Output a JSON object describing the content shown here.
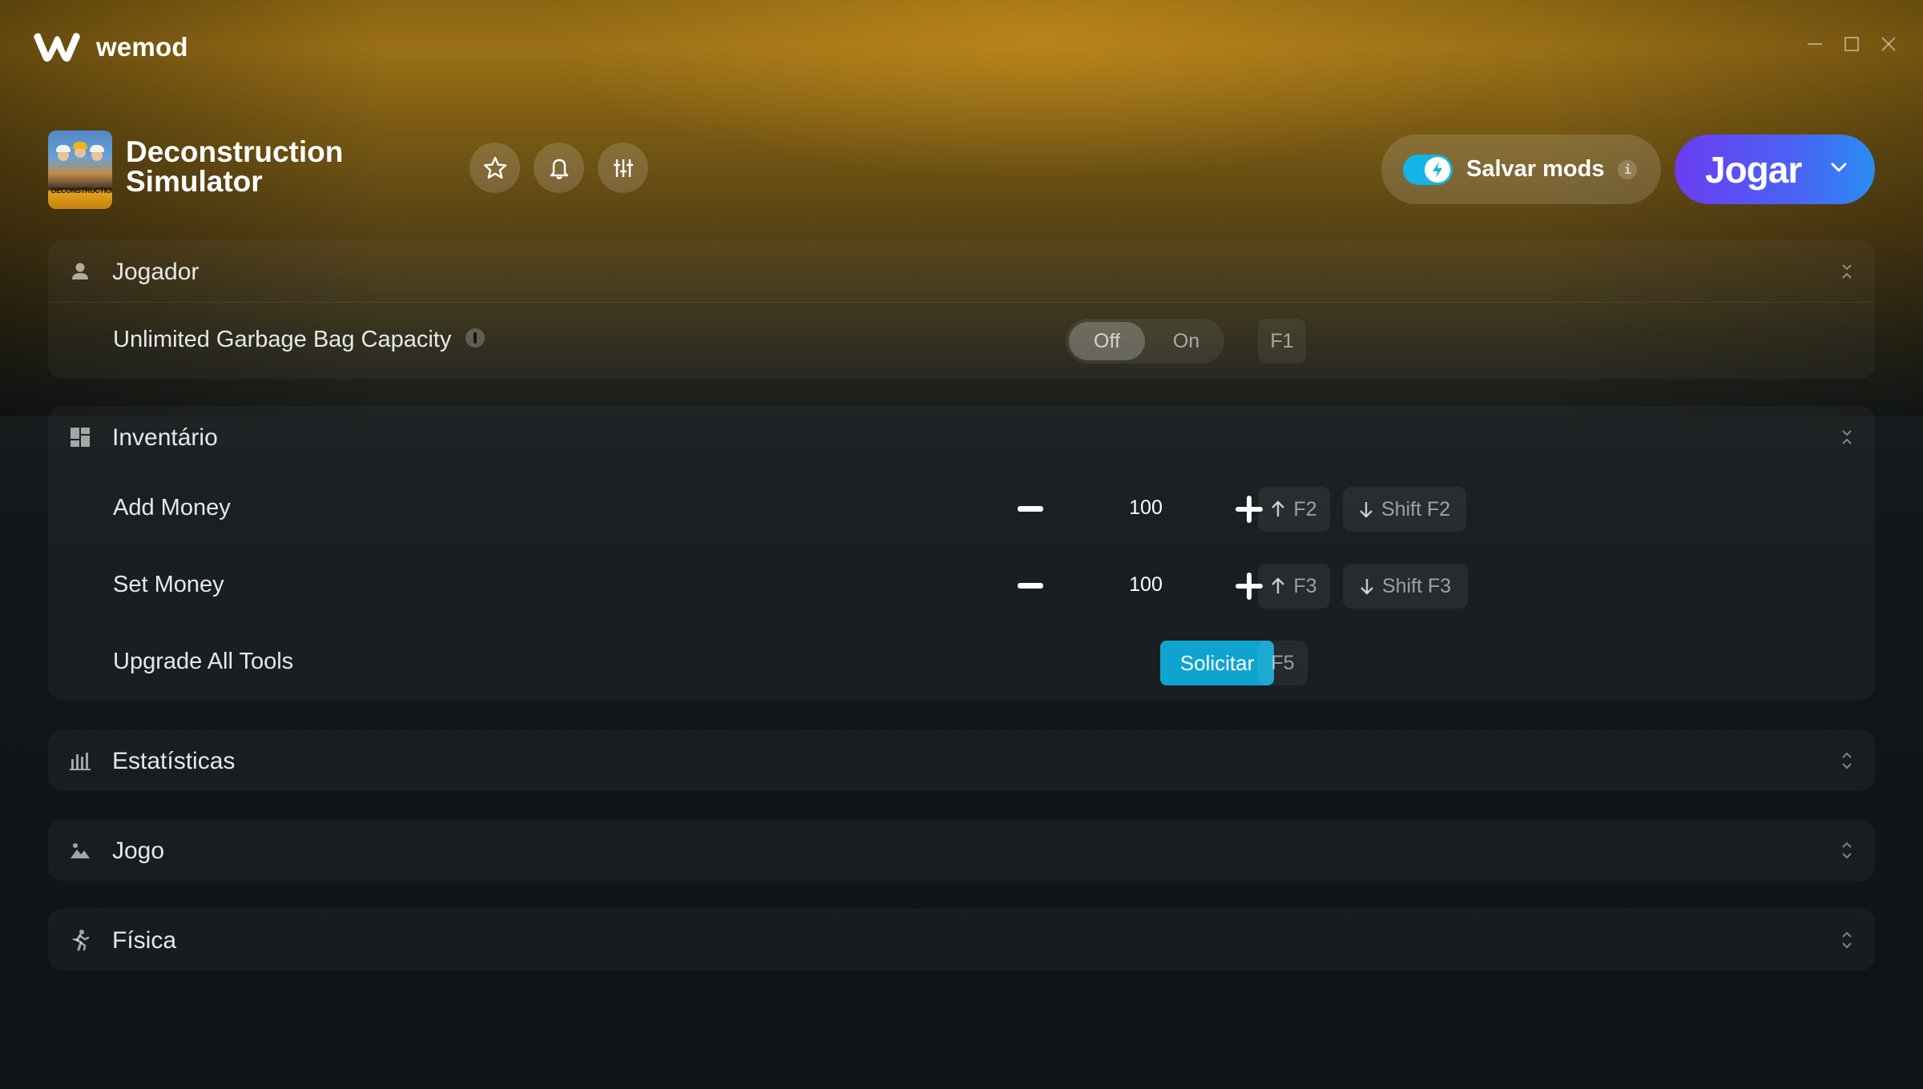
{
  "app": {
    "brand_name": "wemod",
    "window_controls": [
      "minimize-icon",
      "maximize-icon",
      "close-icon"
    ]
  },
  "game": {
    "title_line1": "Deconstruction",
    "title_line2": "Simulator",
    "cover_text": "DECONSTRUCTION",
    "header_icons": [
      "star-icon",
      "bell-icon",
      "sliders-icon"
    ]
  },
  "header": {
    "save_mods_label": "Salvar mods",
    "save_mods_enabled": true,
    "info_label": "i",
    "play_label": "Jogar"
  },
  "colors": {
    "accent": "#13b4e6",
    "apply_button": "#0fa4cf",
    "play_gradient_start": "#6b3cf2",
    "play_gradient_end": "#2a8cf3"
  },
  "categories": [
    {
      "title": "Jogador",
      "icon": "user-icon",
      "expanded": true,
      "mods": [
        {
          "name": "Unlimited Garbage Bag Capacity",
          "type": "toggle",
          "off_label": "Off",
          "on_label": "On",
          "value": "Off",
          "hotkey": "F1"
        }
      ]
    },
    {
      "title": "Inventário",
      "icon": "dashboard-icon",
      "expanded": true,
      "mods": [
        {
          "name": "Add Money",
          "type": "stepper",
          "value": "100",
          "hotkey_up": "F2",
          "hotkey_down": "Shift F2"
        },
        {
          "name": "Set Money",
          "type": "stepper",
          "value": "100",
          "hotkey_up": "F3",
          "hotkey_down": "Shift F3"
        },
        {
          "name": "Upgrade All Tools",
          "type": "button",
          "button_label": "Solicitar",
          "hotkey": "F5"
        }
      ]
    },
    {
      "title": "Estatísticas",
      "icon": "bar-chart-icon",
      "expanded": false
    },
    {
      "title": "Jogo",
      "icon": "landscape-icon",
      "expanded": false
    },
    {
      "title": "Física",
      "icon": "running-person-icon",
      "expanded": false
    }
  ]
}
